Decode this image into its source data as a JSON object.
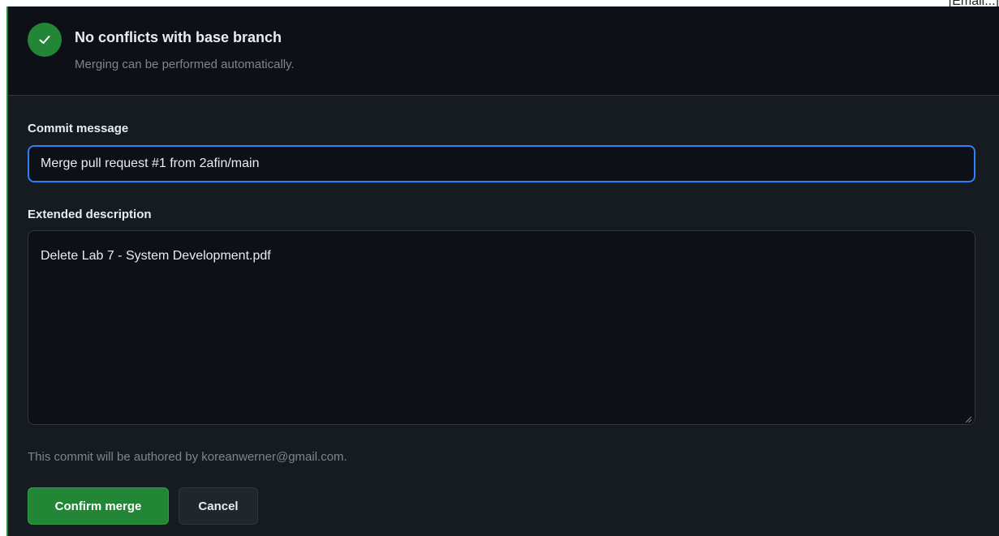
{
  "corner": {
    "text": "[Email...]"
  },
  "status": {
    "title": "No conflicts with base branch",
    "subtitle": "Merging can be performed automatically.",
    "icon": "check-icon",
    "color": "#238636"
  },
  "form": {
    "commit_label": "Commit message",
    "commit_value": "Merge pull request #1 from 2afin/main",
    "description_label": "Extended description",
    "description_value": "Delete Lab 7 - System Development.pdf",
    "author_note": "This commit will be authored by koreanwerner@gmail.com."
  },
  "actions": {
    "confirm_label": "Confirm merge",
    "cancel_label": "Cancel"
  },
  "colors": {
    "accent": "#2f81f7",
    "success": "#238636",
    "background": "#0d1117"
  }
}
